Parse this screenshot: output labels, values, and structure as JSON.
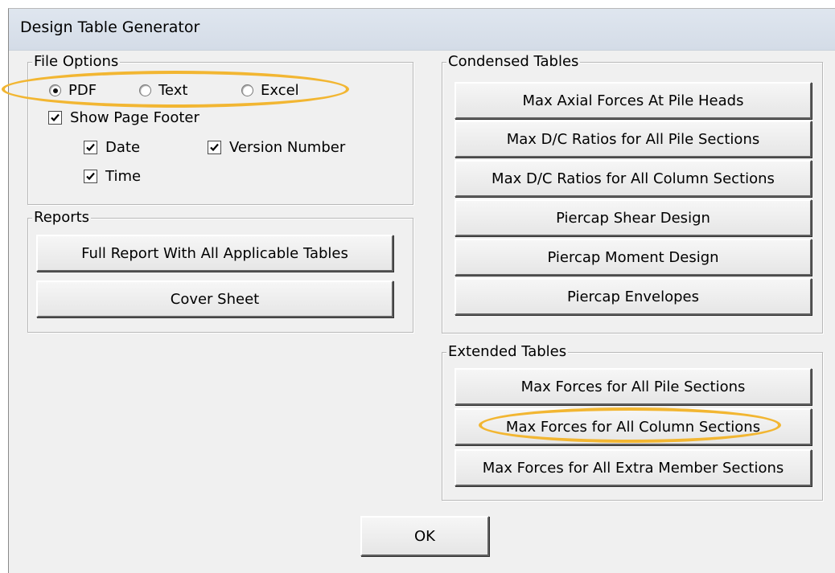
{
  "window": {
    "title": "Design Table Generator"
  },
  "file_options": {
    "legend": "File Options",
    "format_radios": [
      {
        "label": "PDF",
        "checked": true
      },
      {
        "label": "Text",
        "checked": false
      },
      {
        "label": "Excel",
        "checked": false
      }
    ],
    "show_page_footer": {
      "label": "Show Page Footer",
      "checked": true
    },
    "date": {
      "label": "Date",
      "checked": true
    },
    "version_number": {
      "label": "Version Number",
      "checked": true
    },
    "time": {
      "label": "Time",
      "checked": true
    }
  },
  "reports": {
    "legend": "Reports",
    "buttons": [
      {
        "label": "Full Report With All Applicable Tables"
      },
      {
        "label": "Cover Sheet"
      }
    ]
  },
  "condensed_tables": {
    "legend": "Condensed Tables",
    "buttons": [
      {
        "label": "Max Axial Forces At Pile Heads"
      },
      {
        "label": "Max D/C Ratios for All Pile Sections"
      },
      {
        "label": "Max D/C Ratios for All Column Sections"
      },
      {
        "label": "Piercap Shear Design"
      },
      {
        "label": "Piercap Moment Design"
      },
      {
        "label": "Piercap Envelopes"
      }
    ]
  },
  "extended_tables": {
    "legend": "Extended Tables",
    "buttons": [
      {
        "label": "Max Forces for All Pile Sections"
      },
      {
        "label": "Max Forces for All Column Sections"
      },
      {
        "label": "Max Forces for All Extra Member Sections"
      }
    ]
  },
  "footer": {
    "ok_label": "OK"
  },
  "colors": {
    "dialog_background": "#f0f0f0",
    "titlebar": "#d4dce7",
    "highlight_annotation": "#f2b632"
  }
}
